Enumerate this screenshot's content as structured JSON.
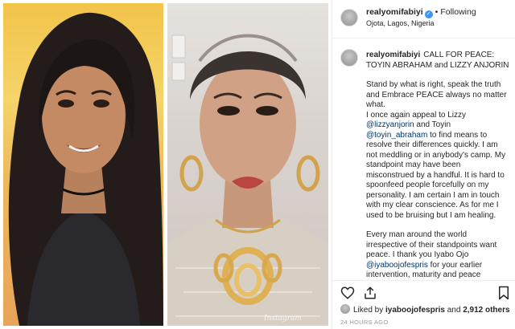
{
  "header": {
    "username": "realyomifabiyi",
    "dot": "•",
    "follow_status": "Following",
    "location": "Ojota, Lagos, Nigeria"
  },
  "caption": {
    "username": "realyomifabiyi",
    "title": "CALL FOR PEACE: TOYIN ABRAHAM and LIZZY ANJORIN",
    "p1": "Stand by what is right, speak the truth and Embrace PEACE always no matter what.",
    "p2_a": "I once again appeal to Lizzy ",
    "p2_m1": "@lizzyanjorin",
    "p2_b": " and Toyin ",
    "p2_m2": "@toyin_abraham",
    "p2_c": " to find means to resolve their differences quickly. I am not meddling or in anybody's camp. My standpoint may have been misconstrued by a handful. It is hard to spoonfeed people forcefully on my personality. I am certain I am in touch with my clear conscience. As for me I used to be bruising but I am healing.",
    "p3_a": "Every man around the world irrespective of their standpoints want peace. I thank you Iyabo Ojo ",
    "p3_m1": "@iyaboojofespris",
    "p3_b": " for your earlier intervention, maturity and peace"
  },
  "likes": {
    "prefix": "Liked by ",
    "user": "iyaboojofespris",
    "mid": " and ",
    "others": "2,912 others"
  },
  "timestamp": "24 HOURS AGO",
  "media": {
    "watermark": "Instagram"
  },
  "icons": {
    "heart": "heart-icon",
    "share": "share-icon",
    "bookmark": "bookmark-icon",
    "verified": "verified-badge-icon"
  }
}
